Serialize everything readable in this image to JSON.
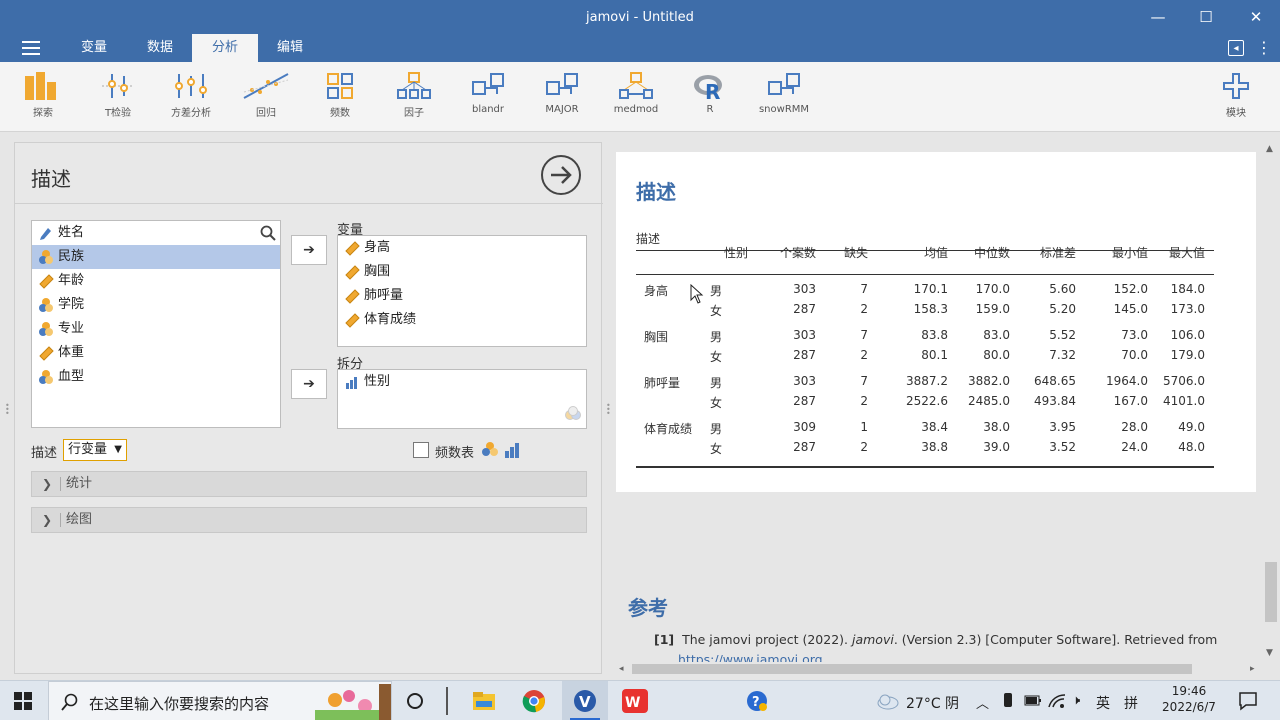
{
  "window": {
    "title": "jamovi - Untitled"
  },
  "menu": {
    "tabs": [
      "变量",
      "数据",
      "分析",
      "编辑"
    ],
    "active_tab": "分析"
  },
  "ribbon": {
    "tools": [
      "探索",
      "T检验",
      "方差分析",
      "回归",
      "频数",
      "因子",
      "blandr",
      "MAJOR",
      "medmod",
      "R",
      "snowRMM"
    ],
    "modules_label": "模块"
  },
  "analysis": {
    "title": "描述",
    "variables_source": [
      {
        "name": "姓名",
        "type": "nominal-text"
      },
      {
        "name": "民族",
        "type": "nominal",
        "selected": true
      },
      {
        "name": "年龄",
        "type": "continuous"
      },
      {
        "name": "学院",
        "type": "nominal"
      },
      {
        "name": "专业",
        "type": "nominal"
      },
      {
        "name": "体重",
        "type": "continuous"
      },
      {
        "name": "血型",
        "type": "nominal"
      }
    ],
    "variables_label": "变量",
    "variables_target": [
      "身高",
      "胸围",
      "肺呼量",
      "体育成绩"
    ],
    "split_label": "拆分",
    "split_target": [
      "性别"
    ],
    "describe_label": "描述",
    "describe_option": "行变量",
    "freq_table_label": "频数表",
    "sections": [
      "统计",
      "绘图"
    ]
  },
  "results": {
    "title": "描述",
    "table_caption": "描述",
    "columns": [
      "性别",
      "个案数",
      "缺失",
      "均值",
      "中位数",
      "标准差",
      "最小值",
      "最大值"
    ],
    "rows": [
      {
        "var": "身高",
        "group": "男",
        "n": "303",
        "missing": "7",
        "mean": "170.1",
        "median": "170.0",
        "sd": "5.60",
        "min": "152.0",
        "max": "184.0"
      },
      {
        "var": "",
        "group": "女",
        "n": "287",
        "missing": "2",
        "mean": "158.3",
        "median": "159.0",
        "sd": "5.20",
        "min": "145.0",
        "max": "173.0"
      },
      {
        "var": "胸围",
        "group": "男",
        "n": "303",
        "missing": "7",
        "mean": "83.8",
        "median": "83.0",
        "sd": "5.52",
        "min": "73.0",
        "max": "106.0"
      },
      {
        "var": "",
        "group": "女",
        "n": "287",
        "missing": "2",
        "mean": "80.1",
        "median": "80.0",
        "sd": "7.32",
        "min": "70.0",
        "max": "179.0"
      },
      {
        "var": "肺呼量",
        "group": "男",
        "n": "303",
        "missing": "7",
        "mean": "3887.2",
        "median": "3882.0",
        "sd": "648.65",
        "min": "1964.0",
        "max": "5706.0"
      },
      {
        "var": "",
        "group": "女",
        "n": "287",
        "missing": "2",
        "mean": "2522.6",
        "median": "2485.0",
        "sd": "493.84",
        "min": "167.0",
        "max": "4101.0"
      },
      {
        "var": "体育成绩",
        "group": "男",
        "n": "309",
        "missing": "1",
        "mean": "38.4",
        "median": "38.0",
        "sd": "3.95",
        "min": "28.0",
        "max": "49.0"
      },
      {
        "var": "",
        "group": "女",
        "n": "287",
        "missing": "2",
        "mean": "38.8",
        "median": "39.0",
        "sd": "3.52",
        "min": "24.0",
        "max": "48.0"
      }
    ],
    "references_title": "参考",
    "reference_index": "[1]",
    "reference_text_a": "The jamovi project (2022). ",
    "reference_text_b": "jamovi",
    "reference_text_c": ". (Version 2.3) [Computer Software]. Retrieved from",
    "reference_link": "https://www.jamovi.org"
  },
  "taskbar": {
    "search_placeholder": "在这里输入你要搜索的内容",
    "weather": "27°C  阴",
    "ime": "英",
    "ime2": "拼",
    "time": "19:46",
    "date": "2022/6/7"
  }
}
